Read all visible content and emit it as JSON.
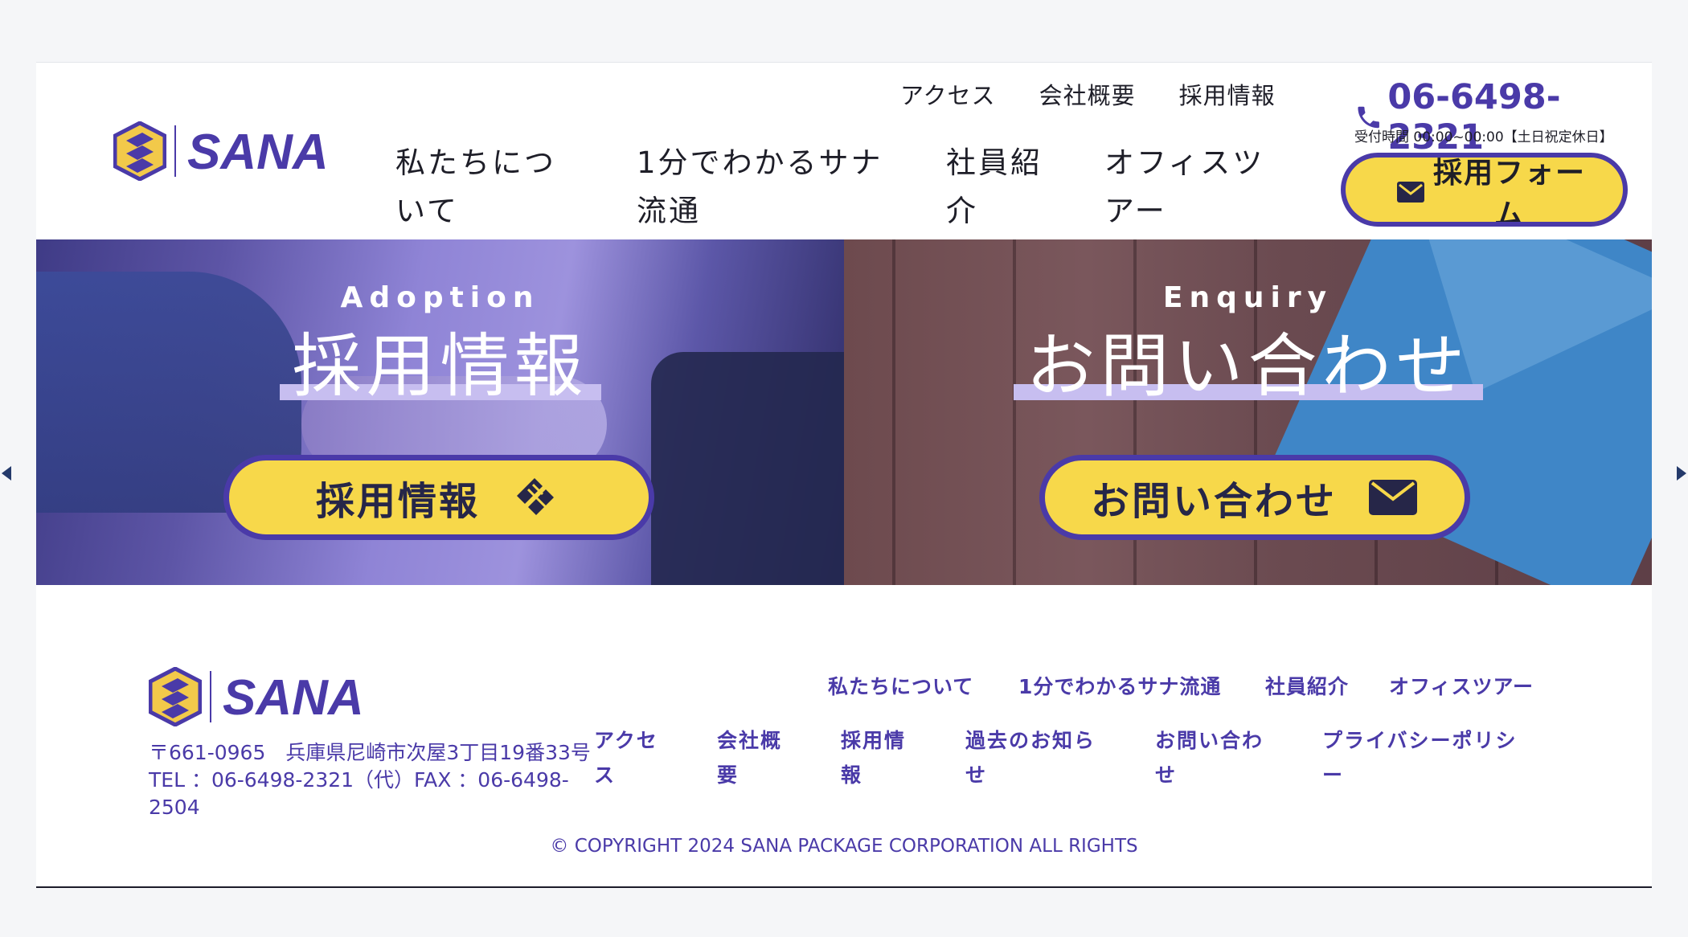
{
  "header": {
    "util_nav": [
      "アクセス",
      "会社概要",
      "採用情報"
    ],
    "main_nav": [
      "私たちについて",
      "1分でわかるサナ流通",
      "社員紹介",
      "オフィスツアー"
    ],
    "phone": "06-6498-2321",
    "hours": "受付時間 00:00~00:00【土日祝定休日】",
    "form_button": "採用フォーム",
    "logo_text": "SANA"
  },
  "panels": {
    "adoption": {
      "en": "Adoption",
      "jp": "採用情報",
      "button": "採用情報",
      "icon": "handshake-icon"
    },
    "enquiry": {
      "en": "Enquiry",
      "jp": "お問い合わせ",
      "button": "お問い合わせ",
      "icon": "mail-icon"
    }
  },
  "footer": {
    "logo_text": "SANA",
    "address_line": "〒661-0965　兵庫県尼崎市次屋3丁目19番33号",
    "tel_line": "TEL ：06-6498-2321（代）FAX ：06-6498-2504",
    "nav_row1": [
      "私たちについて",
      "1分でわかるサナ流通",
      "社員紹介",
      "オフィスツアー"
    ],
    "nav_row2": [
      "アクセス",
      "会社概要",
      "採用情報",
      "過去のお知らせ",
      "お問い合わせ",
      "プライバシーポリシー"
    ],
    "copyright": "© COPYRIGHT 2024 SANA PACKAGE CORPORATION ALL RIGHTS"
  },
  "colors": {
    "brand_purple": "#4a3aa8",
    "accent_yellow": "#f7d84a",
    "text_dark": "#1e1e28"
  }
}
